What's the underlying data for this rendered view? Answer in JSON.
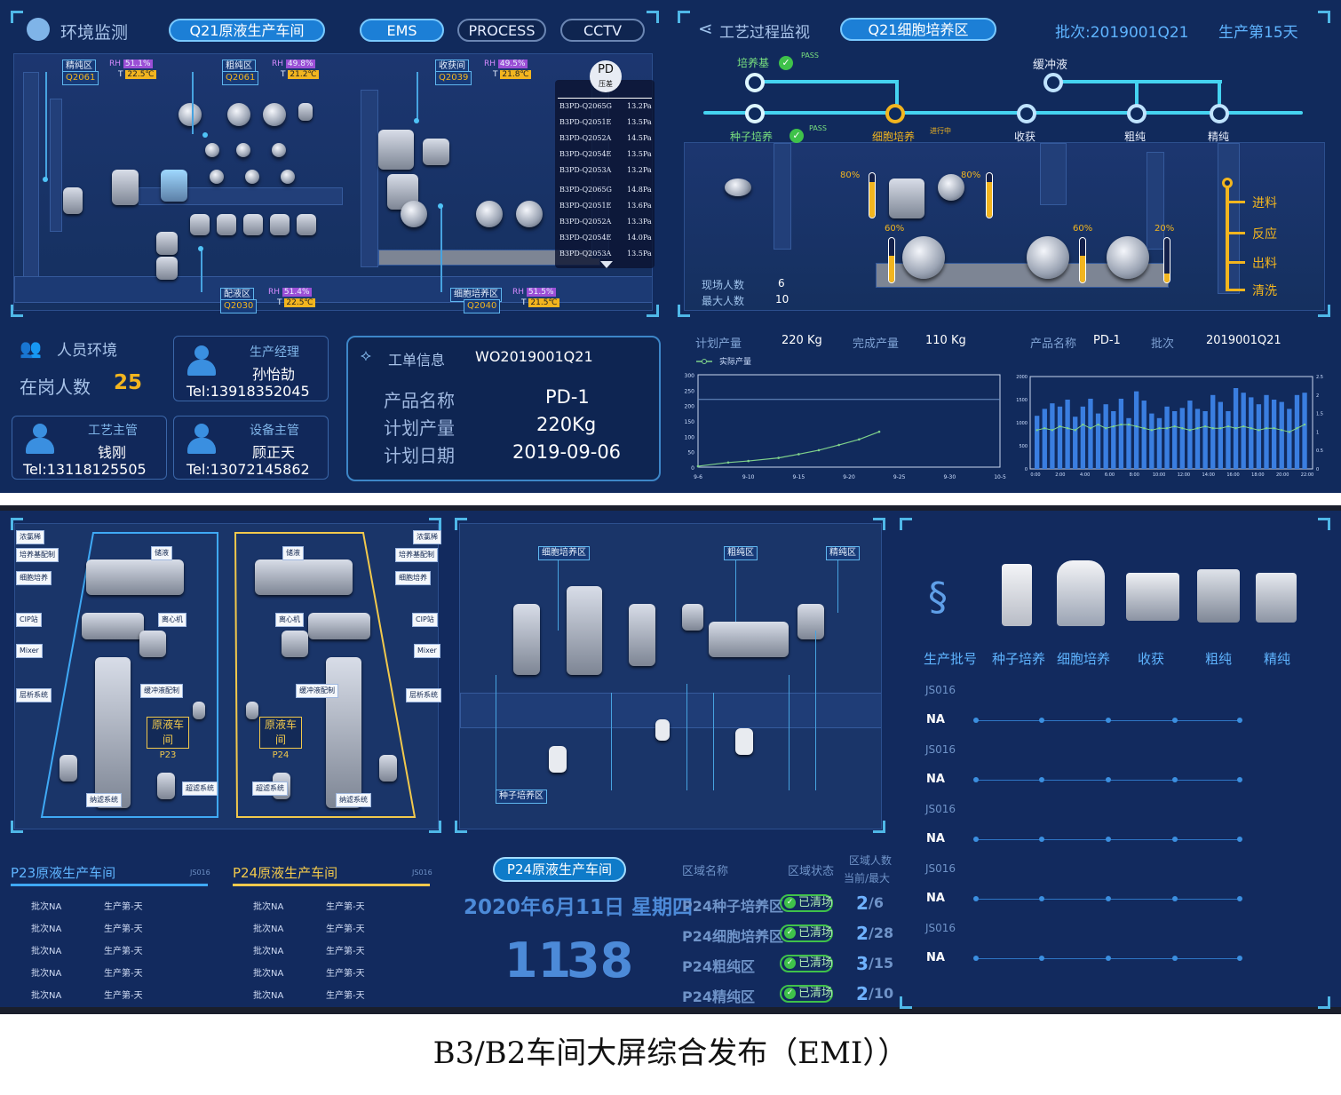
{
  "top": {
    "env": {
      "title": "环境监测",
      "area_pill": "Q21原液生产车间",
      "nav": [
        "EMS",
        "PROCESS",
        "CCTV"
      ],
      "rooms": [
        {
          "name": "精纯区",
          "code": "Q2061",
          "rh": "51.1%",
          "t": "22.5℃"
        },
        {
          "name": "粗纯区",
          "code": "Q2061",
          "rh": "49.8%",
          "t": "21.2℃"
        },
        {
          "name": "收获间",
          "code": "Q2039",
          "rh": "49.5%",
          "t": "21.8℃"
        },
        {
          "name": "配液区",
          "code": "Q2030",
          "rh": "51.4%",
          "t": "22.5℃"
        },
        {
          "name": "细胞培养区",
          "code": "Q2040",
          "rh": "51.5%",
          "t": "21.5℃"
        }
      ],
      "rh_label": "RH",
      "t_label": "T",
      "pd": {
        "title": "PD",
        "sub": "压差",
        "rows": [
          [
            "B3PD-Q2065G",
            "13.2Pa"
          ],
          [
            "B3PD-Q2051E",
            "13.5Pa"
          ],
          [
            "B3PD-Q2052A",
            "14.5Pa"
          ],
          [
            "B3PD-Q2054E",
            "13.5Pa"
          ],
          [
            "B3PD-Q2053A",
            "13.2Pa"
          ],
          [
            "B3PD-Q2065G",
            "14.8Pa"
          ],
          [
            "B3PD-Q2051E",
            "13.6Pa"
          ],
          [
            "B3PD-Q2052A",
            "13.3Pa"
          ],
          [
            "B3PD-Q2054E",
            "14.0Pa"
          ],
          [
            "B3PD-Q2053A",
            "13.5Pa"
          ]
        ]
      }
    },
    "process": {
      "title": "工艺过程监视",
      "area_pill": "Q21细胞培养区",
      "batch": "批次:2019001Q21",
      "day": "生产第15天",
      "stages": {
        "medium": "培养基",
        "buffer": "缓冲液",
        "seed": "种子培养",
        "cell": "细胞培养",
        "cell_status": "进行中",
        "harvest": "收获",
        "rough": "粗纯",
        "fine": "精纯",
        "pass": "PASS"
      },
      "gauges": [
        {
          "label": "80%",
          "level": 0.8
        },
        {
          "label": "80%",
          "level": 0.8
        },
        {
          "label": "60%",
          "level": 0.6
        },
        {
          "label": "60%",
          "level": 0.6
        },
        {
          "label": "20%",
          "level": 0.2
        }
      ],
      "steps": [
        "进料",
        "反应",
        "出料",
        "清洗"
      ],
      "onsite_label": "现场人数",
      "onsite": "6",
      "max_label": "最大人数",
      "max": "10"
    },
    "people": {
      "title": "人员环境",
      "onduty_label": "在岗人数",
      "onduty": "25",
      "cards": [
        {
          "role": "生产经理",
          "name": "孙怡劼",
          "tel": "Tel:13918352045"
        },
        {
          "role": "工艺主管",
          "name": "钱刚",
          "tel": "Tel:13118125505"
        },
        {
          "role": "设备主管",
          "name": "顾正天",
          "tel": "Tel:13072145862"
        }
      ]
    },
    "workorder": {
      "title": "工单信息",
      "wo": "WO2019001Q21",
      "k1": "产品名称",
      "v1": "PD-1",
      "k2": "计划产量",
      "v2": "220Kg",
      "k3": "计划日期",
      "v3": "2019-09-06"
    },
    "stats": {
      "plan_label": "计划产量",
      "plan": "220 Kg",
      "done_label": "完成产量",
      "done": "110 Kg",
      "prod_label": "产品名称",
      "prod": "PD-1",
      "batch_label": "批次",
      "batch": "2019001Q21"
    }
  },
  "chart_data": [
    {
      "type": "line",
      "legend": "实际产量",
      "x": [
        "9-6",
        "9-10",
        "9-15",
        "9-20",
        "9-25",
        "9-30",
        "10-5"
      ],
      "ylim": [
        0,
        300
      ],
      "yticks": [
        0,
        50,
        100,
        150,
        200,
        250,
        300
      ],
      "reference": 220,
      "series": [
        {
          "name": "实际产量",
          "points": [
            [
              0,
              3
            ],
            [
              0.6,
              15
            ],
            [
              1.0,
              20
            ],
            [
              1.6,
              30
            ],
            [
              2.0,
              42
            ],
            [
              2.4,
              55
            ],
            [
              2.8,
              72
            ],
            [
              3.2,
              90
            ],
            [
              3.6,
              115
            ]
          ]
        }
      ]
    },
    {
      "type": "bar",
      "x": [
        "0:00",
        "2:00",
        "4:00",
        "6:00",
        "8:00",
        "10:00",
        "12:00",
        "14:00",
        "16:00",
        "18:00",
        "20:00",
        "22:00"
      ],
      "ylim": [
        0,
        2000
      ],
      "yticks": [
        0,
        500,
        1000,
        1500,
        2000
      ],
      "y2ticks": [
        "0",
        "0.5",
        "1",
        "1.5",
        "2",
        "2.5"
      ],
      "values": [
        1150,
        1300,
        1420,
        1350,
        1500,
        1130,
        1350,
        1520,
        1200,
        1400,
        1250,
        1520,
        1100,
        1680,
        1480,
        1200,
        1100,
        1350,
        1250,
        1320,
        1480,
        1300,
        1250,
        1600,
        1450,
        1250,
        1750,
        1650,
        1550,
        1400,
        1600,
        1500,
        1450,
        1300,
        1600,
        1650
      ],
      "line": [
        1.05,
        1.1,
        1.05,
        1.15,
        1.1,
        1.05,
        1.2,
        1.1,
        1.2,
        1.1,
        1.15,
        1.2,
        1.2,
        1.15,
        1.1,
        1.05,
        1.1,
        1.1,
        1.15,
        1.1,
        1.05,
        1.1,
        1.15,
        1.1,
        1.1,
        1.15,
        1.1,
        1.15,
        1.1,
        1.05,
        1.1,
        1.1,
        1.05,
        1.0,
        1.1,
        1.2
      ]
    }
  ],
  "bottom": {
    "p23": {
      "title": "P23原液生产车间",
      "batch": "JS016",
      "room_label": "原液车间",
      "room_code": "P23",
      "labels": [
        "浓氯稀",
        "培养基配制",
        "细胞培养",
        "CIP站",
        "Mixer",
        "层析系统",
        "缓冲液配制",
        "离心机",
        "储液",
        "超滤系统",
        "纳滤系统"
      ]
    },
    "p24": {
      "title": "P24原液生产车间",
      "batch": "JS016",
      "room_label": "原液车间",
      "room_code": "P24",
      "labels": [
        "浓氯稀",
        "培养基配制",
        "细胞培养",
        "CIP站",
        "Mixer",
        "层析系统",
        "缓冲液配制",
        "离心机",
        "储液",
        "超滤系统",
        "纳滤系统"
      ]
    },
    "list_rows": [
      [
        "批次NA",
        "生产第-天"
      ],
      [
        "批次NA",
        "生产第-天"
      ],
      [
        "批次NA",
        "生产第-天"
      ],
      [
        "批次NA",
        "生产第-天"
      ],
      [
        "批次NA",
        "生产第-天"
      ]
    ],
    "mid": {
      "zones": [
        "细胞培养区",
        "粗纯区",
        "精纯区",
        "种子培养区"
      ],
      "pill": "P24原液生产车间",
      "date": "2020年6月11日 星期四",
      "time_h": "11",
      "time_m": "38"
    },
    "zone_table": {
      "h1": "区域名称",
      "h2": "区域状态",
      "h3a": "区域人数",
      "h3b": "当前/最大",
      "rows": [
        {
          "name": "P24种子培养区",
          "status": "已清场",
          "cur": "2",
          "max": "/6"
        },
        {
          "name": "P24细胞培养区",
          "status": "已清场",
          "cur": "2",
          "max": "/28"
        },
        {
          "name": "P24粗纯区",
          "status": "已清场",
          "cur": "3",
          "max": "/15"
        },
        {
          "name": "P24精纯区",
          "status": "已清场",
          "cur": "2",
          "max": "/10"
        }
      ]
    },
    "flow": {
      "headers": [
        "生产批号",
        "种子培养",
        "细胞培养",
        "收获",
        "粗纯",
        "精纯"
      ],
      "rows": [
        {
          "batch": "JS016",
          "val": "NA"
        },
        {
          "batch": "JS016",
          "val": "NA"
        },
        {
          "batch": "JS016",
          "val": "NA"
        },
        {
          "batch": "JS016",
          "val": "NA"
        },
        {
          "batch": "JS016",
          "val": "NA"
        }
      ]
    }
  },
  "caption": "B3/B2车间大屏综合发布（EMI））",
  "colors": {
    "accent": "#1c7fd6",
    "gold": "#f2b51f",
    "green": "#3fc24a",
    "bg": "#112a5c"
  }
}
